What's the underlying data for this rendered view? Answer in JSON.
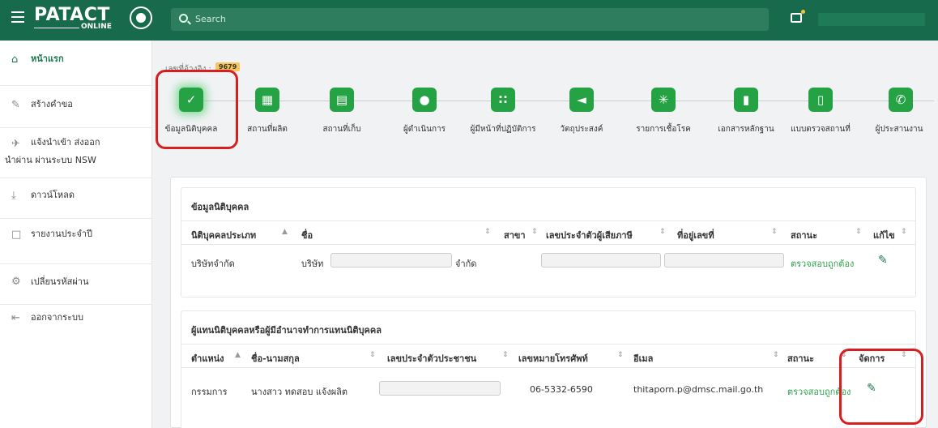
{
  "topbar": {
    "logo_text": "PATACT",
    "logo_sub": "ONLINE",
    "search_placeholder": "Search"
  },
  "sidebar": {
    "items": [
      {
        "label": "หน้าแรก",
        "icon": "home-icon",
        "active": true
      },
      {
        "label": "สร้างคำขอ",
        "icon": "pencil-icon"
      },
      {
        "label": "แจ้งนำเข้า ส่งออก",
        "label2": "นำผ่าน ผ่านระบบ NSW",
        "icon": "plane-icon"
      },
      {
        "label": "ดาวน์โหลด",
        "icon": "download-icon"
      },
      {
        "label": "รายงานประจำปี",
        "icon": "document-icon"
      },
      {
        "label": "เปลี่ยนรหัสผ่าน",
        "icon": "gears-icon"
      },
      {
        "label": "ออกจากระบบ",
        "icon": "logout-icon"
      }
    ]
  },
  "reference": {
    "label": "เลขที่อ้างอิง :",
    "value": "9679"
  },
  "steps": [
    {
      "label": "ข้อมูลนิติบุคคล",
      "icon": "check-icon"
    },
    {
      "label": "สถานที่ผลิต",
      "icon": "building-icon"
    },
    {
      "label": "สถานที่เก็บ",
      "icon": "archive-icon"
    },
    {
      "label": "ผู้ดำเนินการ",
      "icon": "user-icon"
    },
    {
      "label": "ผู้มีหน้าที่ปฏิบัติการ",
      "icon": "users-icon"
    },
    {
      "label": "วัตถุประสงค์",
      "icon": "megaphone-icon"
    },
    {
      "label": "รายการเชื้อโรค",
      "icon": "germs-icon"
    },
    {
      "label": "เอกสารหลักฐาน",
      "icon": "file-icon"
    },
    {
      "label": "แบบตรวจสถานที่",
      "icon": "clipboard-icon"
    },
    {
      "label": "ผู้ประสานงาน",
      "icon": "phone-icon"
    }
  ],
  "juristic": {
    "title": "ข้อมูลนิติบุคคล",
    "columns": [
      "นิติบุคคลประเภท",
      "ชื่อ",
      "สาขา",
      "เลขประจำตัวผู้เสียภาษี",
      "ที่อยู่เลขที่",
      "สถานะ",
      "แก้ไข"
    ],
    "row": {
      "type": "บริษัทจำกัด",
      "prefix": "บริษัท",
      "suffix": "จำกัด",
      "status": "ตรวจสอบถูกต้อง"
    }
  },
  "representative": {
    "title": "ผู้แทนนิติบุคคลหรือผู้มีอำนาจทำการแทนนิติบุคคล",
    "columns": [
      "ตำแหน่ง",
      "ชื่อ-นามสกุล",
      "เลขประจำตัวประชาชน",
      "เลขหมายโทรศัพท์",
      "อีเมล",
      "สถานะ",
      "จัดการ"
    ],
    "row": {
      "position": "กรรมการ",
      "name": "นางสาว ทดสอบ แจ้งผลิต",
      "phone": "06-5332-6590",
      "email": "thitaporn.p@dmsc.mail.go.th",
      "status": "ตรวจสอบถูกต้อง"
    }
  },
  "colors": {
    "topbar": "#176a4c",
    "accent": "#25a244",
    "status": "#2aa34a",
    "highlight": "#d81e1e"
  }
}
